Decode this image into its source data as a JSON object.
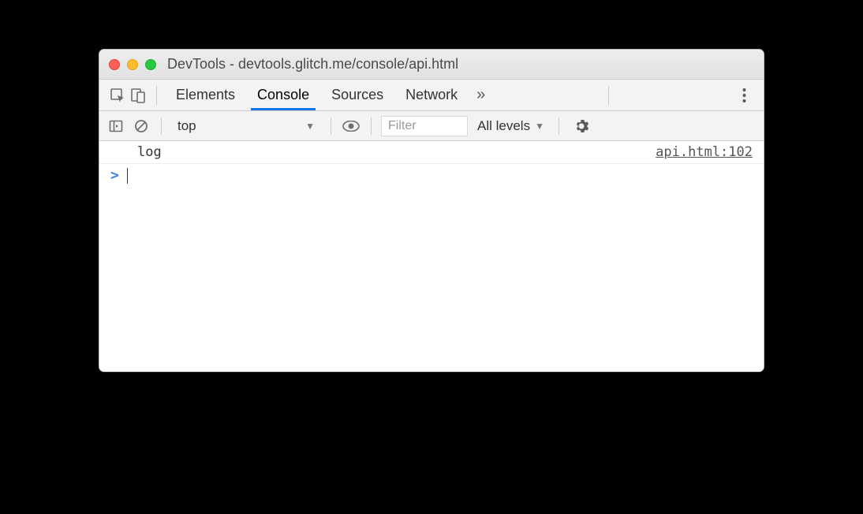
{
  "window": {
    "title": "DevTools - devtools.glitch.me/console/api.html"
  },
  "toolbar": {
    "tabs": {
      "elements": "Elements",
      "console": "Console",
      "sources": "Sources",
      "network": "Network"
    },
    "active_tab": "console",
    "more_label": "»"
  },
  "subbar": {
    "context": "top",
    "filter_placeholder": "Filter",
    "levels_label": "All levels"
  },
  "console": {
    "entries": [
      {
        "message": "log",
        "source": "api.html:102"
      }
    ],
    "prompt": ">"
  }
}
